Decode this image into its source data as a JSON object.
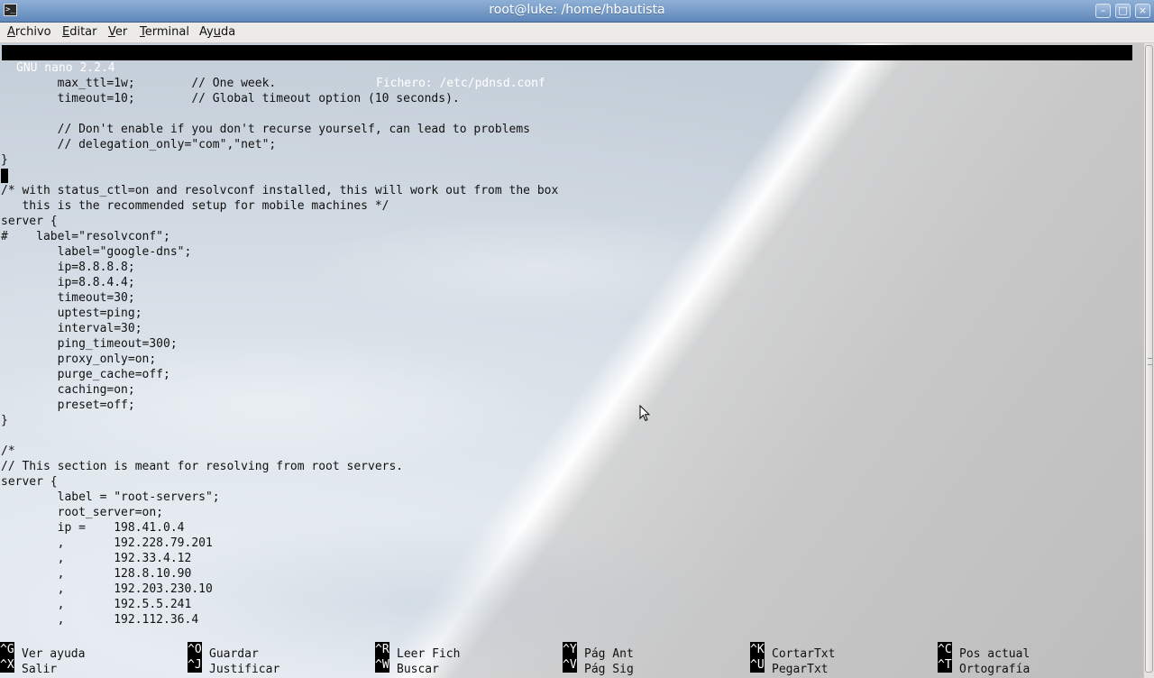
{
  "window": {
    "title": "root@luke: /home/hbautista",
    "app_icon_glyph": ">_",
    "controls": {
      "minimize": "–",
      "maximize": "□",
      "close": "×"
    }
  },
  "menu": [
    {
      "label": "Archivo",
      "mnemonic": "A",
      "rest": "rchivo"
    },
    {
      "label": "Editar",
      "mnemonic": "E",
      "rest": "ditar"
    },
    {
      "label": "Ver",
      "mnemonic": "V",
      "rest": "er"
    },
    {
      "label": "Terminal",
      "mnemonic": "T",
      "rest": "erminal"
    },
    {
      "label": "Ayuda",
      "mnemonic": "u",
      "pre": "Ay",
      "rest": "da"
    }
  ],
  "nano": {
    "version": "GNU nano 2.2.4",
    "file_label": "Fichero: /etc/pdnsd.conf"
  },
  "buffer_lines": [
    "        max_ttl=1w;        // One week.",
    "        timeout=10;        // Global timeout option (10 seconds).",
    "",
    "        // Don't enable if you don't recurse yourself, can lead to problems",
    "        // delegation_only=\"com\",\"net\";",
    "}",
    "",
    "/* with status_ctl=on and resolvconf installed, this will work out from the box",
    "   this is the recommended setup for mobile machines */",
    "server {",
    "#    label=\"resolvconf\";",
    "        label=\"google-dns\";",
    "        ip=8.8.8.8;",
    "        ip=8.8.4.4;",
    "        timeout=30;",
    "        uptest=ping;",
    "        interval=30;",
    "        ping_timeout=300;",
    "        proxy_only=on;",
    "        purge_cache=off;",
    "        caching=on;",
    "        preset=off;",
    "}",
    "",
    "/*",
    "// This section is meant for resolving from root servers.",
    "server {",
    "        label = \"root-servers\";",
    "        root_server=on;",
    "        ip =    198.41.0.4",
    "        ,       192.228.79.201",
    "        ,       192.33.4.12",
    "        ,       128.8.10.90",
    "        ,       192.203.230.10",
    "        ,       192.5.5.241",
    "        ,       192.112.36.4"
  ],
  "shortcuts": [
    {
      "key": "^G",
      "label": "Ver ayuda"
    },
    {
      "key": "^O",
      "label": "Guardar"
    },
    {
      "key": "^R",
      "label": "Leer Fich"
    },
    {
      "key": "^Y",
      "label": "Pág Ant"
    },
    {
      "key": "^K",
      "label": "CortarTxt"
    },
    {
      "key": "^C",
      "label": "Pos actual"
    },
    {
      "key": "^X",
      "label": "Salir"
    },
    {
      "key": "^J",
      "label": "Justificar"
    },
    {
      "key": "^W",
      "label": "Buscar"
    },
    {
      "key": "^V",
      "label": "Pág Sig"
    },
    {
      "key": "^U",
      "label": "PegarTxt"
    },
    {
      "key": "^T",
      "label": "Ortografía"
    }
  ]
}
